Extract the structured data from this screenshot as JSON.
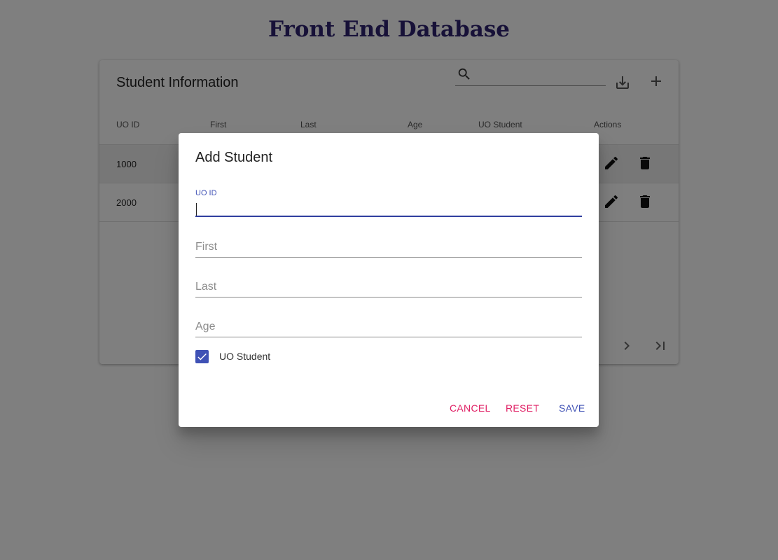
{
  "app": {
    "title": "Front End Database"
  },
  "table": {
    "title": "Student Information",
    "search": {
      "value": "",
      "placeholder": ""
    },
    "icons": {
      "search": "search-icon",
      "export": "download-icon",
      "add": "add-icon"
    },
    "columns": [
      "UO ID",
      "First",
      "Last",
      "Age",
      "UO Student",
      "Actions"
    ],
    "rows": [
      {
        "uo_id": "1000"
      },
      {
        "uo_id": "2000"
      }
    ],
    "row_actions": [
      "edit-icon",
      "delete-icon"
    ],
    "pager_icons": [
      "next-page-icon",
      "last-page-icon"
    ]
  },
  "dialog": {
    "title": "Add Student",
    "fields": {
      "uo_id": {
        "label": "UO ID",
        "value": ""
      },
      "first": {
        "placeholder": "First",
        "value": ""
      },
      "last": {
        "placeholder": "Last",
        "value": ""
      },
      "age": {
        "placeholder": "Age",
        "value": ""
      }
    },
    "uo_student": {
      "label": "UO Student",
      "checked": true
    },
    "buttons": {
      "cancel": "CANCEL",
      "reset": "RESET",
      "save": "SAVE"
    }
  },
  "colors": {
    "title": "#2f2370",
    "accent": "#3f51b5",
    "secondary": "#e01f64",
    "overlay": "rgba(0,0,0,0.5)"
  }
}
